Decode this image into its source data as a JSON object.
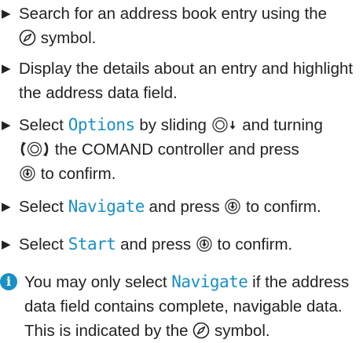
{
  "instructions": {
    "steps": [
      {
        "bullet": "▶",
        "parts": [
          "Search for an address book entry using the",
          "symbol."
        ]
      },
      {
        "bullet": "▶",
        "parts": [
          "Display the details about an entry and highlight the address data field."
        ]
      },
      {
        "bullet": "▶",
        "parts": [
          "Select",
          "Options",
          "by sliding",
          "and turning",
          "the COMAND controller and press",
          "to confirm."
        ]
      },
      {
        "bullet": "▶",
        "parts": [
          "Select",
          "Navigate",
          "and press",
          "to confirm."
        ]
      },
      {
        "bullet": "▶",
        "parts": [
          "Select",
          "Start",
          "and press",
          "to confirm."
        ]
      }
    ],
    "note": {
      "info_icon": "i",
      "parts": [
        "You may only select",
        "Navigate",
        "if the address data field contains complete, navigable data. This is indicated by the",
        "symbol."
      ]
    }
  },
  "colors": {
    "text": "#222222",
    "keyword": "#1a8fc4",
    "info_icon_bg": "#1a8fc4"
  },
  "icons": {
    "navigation_symbol": "compass-circle-icon",
    "slide_down": "controller-slide-down-icon",
    "turn": "controller-turn-icon",
    "press": "controller-press-icon"
  }
}
